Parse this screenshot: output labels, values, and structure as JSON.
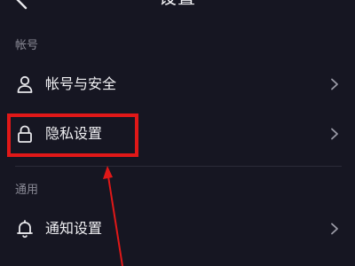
{
  "header": {
    "title": "设置",
    "back_icon": "chevron-left-icon"
  },
  "sections": [
    {
      "label": "帐号",
      "items": [
        {
          "label": "帐号与安全",
          "icon": "person-icon"
        },
        {
          "label": "隐私设置",
          "icon": "lock-icon"
        }
      ]
    },
    {
      "label": "通用",
      "items": [
        {
          "label": "通知设置",
          "icon": "bell-icon"
        }
      ]
    }
  ],
  "colors": {
    "background": "#161622",
    "annotation": "#e01818"
  }
}
